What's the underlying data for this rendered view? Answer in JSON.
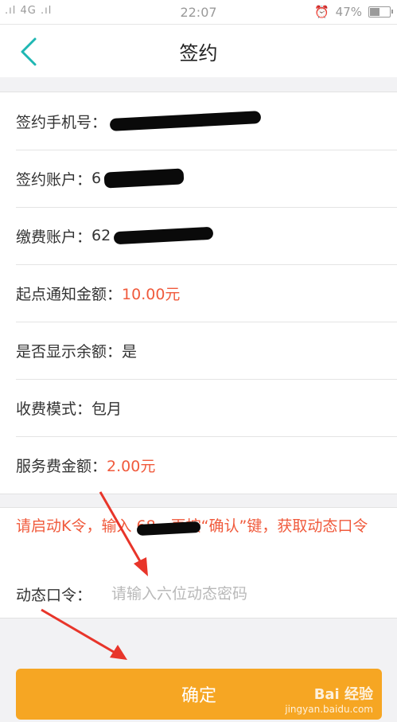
{
  "status_bar": {
    "signal_text": ".ıl 4G .ıl",
    "time": "22:07",
    "battery": "47%",
    "battery_level": 0.47
  },
  "nav": {
    "title": "签约"
  },
  "rows": [
    {
      "label": "签约手机号：",
      "value": ""
    },
    {
      "label": "签约账户：",
      "value": "6"
    },
    {
      "label": "缴费账户：",
      "value": "62"
    },
    {
      "label": "起点通知金额：",
      "value": "10.00元"
    },
    {
      "label": "是否显示余额：",
      "value": "是"
    },
    {
      "label": "收费模式：",
      "value": "包月"
    },
    {
      "label": "服务费金额：",
      "value": "2.00元"
    }
  ],
  "dynamic": {
    "message": "请启动K令，输入      68，再按“确认”键，获取动态口令",
    "label": "动态口令：",
    "placeholder": "请输入六位动态密码"
  },
  "confirm": {
    "label": "确定"
  },
  "watermark": {
    "main": "Bai 经验",
    "sub": "jingyan.baidu.com"
  },
  "colors": {
    "accent": "#f6a623",
    "highlight": "#f05a3c",
    "back": "#1fb7b3"
  }
}
